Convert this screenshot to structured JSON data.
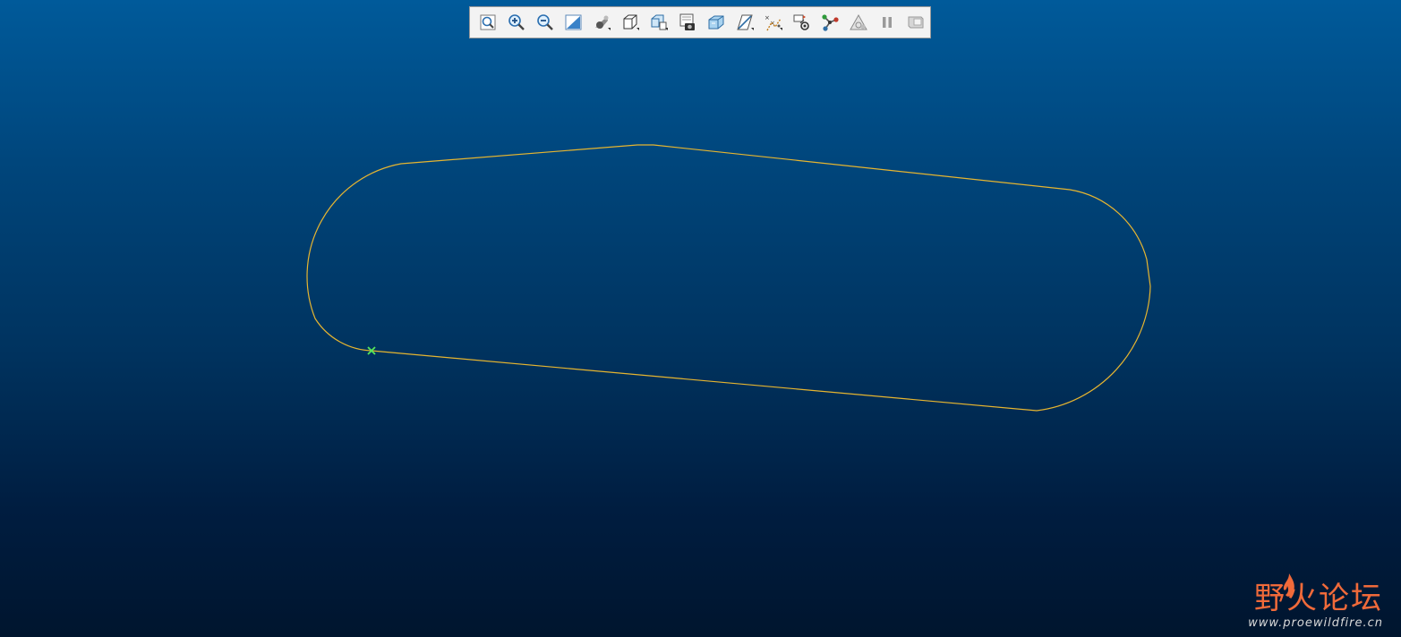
{
  "toolbar": {
    "buttons": [
      {
        "name": "refit-icon",
        "tooltip": "Refit"
      },
      {
        "name": "zoom-in-icon",
        "tooltip": "Zoom In"
      },
      {
        "name": "zoom-out-icon",
        "tooltip": "Zoom Out"
      },
      {
        "name": "repaint-icon",
        "tooltip": "Repaint"
      },
      {
        "name": "display-style-icon",
        "tooltip": "Display Style"
      },
      {
        "name": "saved-orientations-icon",
        "tooltip": "Saved Orientations"
      },
      {
        "name": "view-manager-icon",
        "tooltip": "View Manager"
      },
      {
        "name": "perspective-icon",
        "tooltip": "Perspective"
      },
      {
        "name": "section-icon",
        "tooltip": "Section"
      },
      {
        "name": "datum-display-icon",
        "tooltip": "Datum Display Filters"
      },
      {
        "name": "sketch-display-icon",
        "tooltip": "Sketcher Display Filters"
      },
      {
        "name": "sketch-view-icon",
        "tooltip": "Sketch View"
      },
      {
        "name": "network-icon",
        "tooltip": "Network"
      },
      {
        "name": "warning-triangle-icon",
        "tooltip": "Warnings"
      },
      {
        "name": "pause-icon",
        "tooltip": "Pause"
      },
      {
        "name": "flag-icon",
        "tooltip": "Flag"
      }
    ]
  },
  "colors": {
    "sketch_line": "#e6b530",
    "start_point": "#56e85a",
    "watermark": "#f06a3a"
  },
  "watermark": {
    "title": "野火论坛",
    "url": "www.proewildfire.cn"
  }
}
